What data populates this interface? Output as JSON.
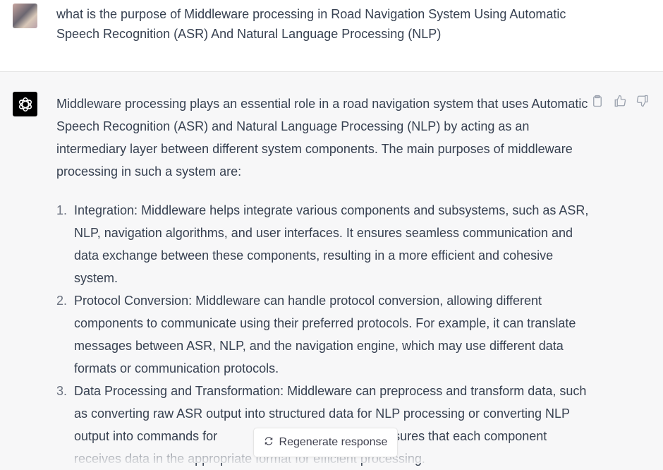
{
  "user_message": {
    "text": "what is the purpose of Middleware processing in Road Navigation System Using Automatic Speech Recognition (ASR) And Natural Language Processing (NLP)"
  },
  "assistant_message": {
    "intro": "Middleware processing plays an essential role in a road navigation system that uses Automatic Speech Recognition (ASR) and Natural Language Processing (NLP) by acting as an intermediary layer between different system components. The main purposes of middleware processing in such a system are:",
    "items": [
      {
        "num": "1.",
        "text": "Integration: Middleware helps integrate various components and subsystems, such as ASR, NLP, navigation algorithms, and user interfaces. It ensures seamless communication and data exchange between these components, resulting in a more efficient and cohesive system."
      },
      {
        "num": "2.",
        "text": "Protocol Conversion: Middleware can handle protocol conversion, allowing different components to communicate using their preferred protocols. For example, it can translate messages between ASR, NLP, and the navigation engine, which may use different data formats or communication protocols."
      },
      {
        "num": "3.",
        "text_a": "Data Processing and Transformation: Middleware can preprocess and transform data, such as converting raw ASR output into structured data for NLP processing or converting NLP output into commands for ",
        "text_b": "is ensures that each component receives data in the appropriate format for efficient processing."
      }
    ]
  },
  "actions": {
    "copy_icon": "clipboard-icon",
    "like_icon": "thumbs-up-icon",
    "dislike_icon": "thumbs-down-icon"
  },
  "regenerate": {
    "label": "Regenerate response",
    "icon": "refresh-icon"
  }
}
